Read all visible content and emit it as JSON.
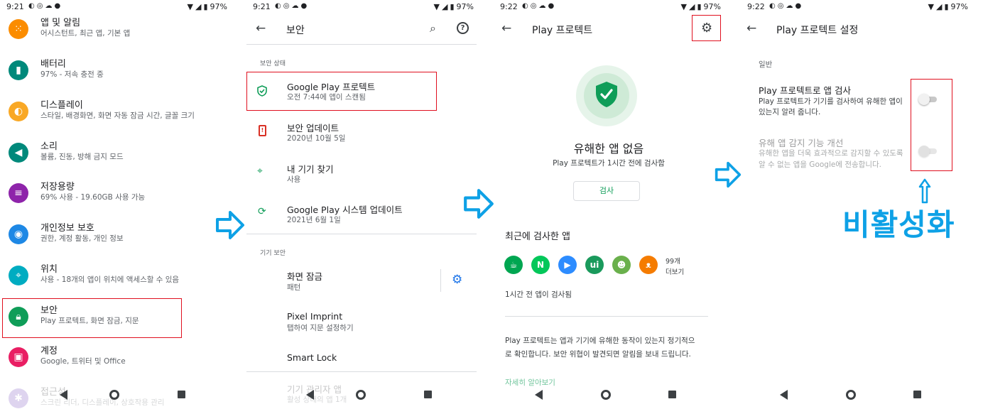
{
  "status": {
    "p1_time": "9:21",
    "p2_time": "9:21",
    "p3_time": "9:22",
    "p4_time": "9:22",
    "battery": "97%"
  },
  "settings": {
    "items": [
      {
        "title": "앱 및 알림",
        "subtitle": "어시스턴트, 최근 앱, 기본 앱",
        "color": "#fb8c00",
        "icon": "apps-grid-icon"
      },
      {
        "title": "배터리",
        "subtitle": "97% - 저속 충전 중",
        "color": "#00897b",
        "icon": "battery-icon"
      },
      {
        "title": "디스플레이",
        "subtitle": "스타일, 배경화면, 화면 자동 잠금 시간, 글꼴 크기",
        "color": "#f9a825",
        "icon": "brightness-icon"
      },
      {
        "title": "소리",
        "subtitle": "볼륨, 진동, 방해 금지 모드",
        "color": "#00897b",
        "icon": "speaker-icon"
      },
      {
        "title": "저장용량",
        "subtitle": "69% 사용 - 19.60GB 사용 가능",
        "color": "#8e24aa",
        "icon": "storage-icon"
      },
      {
        "title": "개인정보 보호",
        "subtitle": "권한, 계정 활동, 개인 정보",
        "color": "#1e88e5",
        "icon": "eye-icon"
      },
      {
        "title": "위치",
        "subtitle": "사용 - 18개의 앱이 위치에 액세스할 수 있음",
        "color": "#00acc1",
        "icon": "location-pin-icon"
      },
      {
        "title": "보안",
        "subtitle": "Play 프로텍트, 화면 잠금, 지문",
        "color": "#0f9d58",
        "icon": "lock-icon"
      },
      {
        "title": "계정",
        "subtitle": "Google, 트위터 및 Office",
        "color": "#e91e63",
        "icon": "account-icon"
      },
      {
        "title": "접근성",
        "subtitle": "스크린 리더, 디스플레이, 상호작용 관리",
        "color": "#7e57c2",
        "icon": "accessibility-icon"
      }
    ]
  },
  "security": {
    "title": "보안",
    "status_header": "보안 상태",
    "items": [
      {
        "title": "Google Play 프로텍트",
        "subtitle": "오전 7:44에 앱이 스캔됨"
      },
      {
        "title": "보안 업데이트",
        "subtitle": "2020년 10월 5일"
      },
      {
        "title": "내 기기 찾기",
        "subtitle": "사용"
      },
      {
        "title": "Google Play 시스템 업데이트",
        "subtitle": "2021년 6월 1일"
      }
    ],
    "device_header": "기기 보안",
    "device_items": [
      {
        "title": "화면 잠금",
        "subtitle": "패턴"
      },
      {
        "title": "Pixel Imprint",
        "subtitle": "탭하여 지문 설정하기"
      },
      {
        "title": "Smart Lock",
        "subtitle": ""
      },
      {
        "title": "기기 관리자 앱",
        "subtitle": "활성 상태의 앱 1개"
      }
    ]
  },
  "protect": {
    "title": "Play 프로텍트",
    "status_title": "유해한 앱 없음",
    "status_sub": "Play 프로텍트가 1시간 전에 검사함",
    "scan_button": "검사",
    "recent_title": "최근에 검사한 앱",
    "app_count": "99개",
    "more": "더보기",
    "scanned_note": "1시간 전 앱이 검사됨",
    "desc_line1": "Play 프로텍트는 앱과 기기에 유해한 동작이 있는지 정기적으",
    "desc_line2": "로 확인합니다. 보안 위협이 발견되면 알림을 보내 드립니다.",
    "learn_more": "자세히 알아보기",
    "accent": "#0f9d58"
  },
  "protect_settings": {
    "title": "Play 프로텍트 설정",
    "section": "일반",
    "opt1_title": "Play 프로텍트로 앱 검사",
    "opt1_line1": "Play 프로텍트가 기기를 검사하여 유해한 앱이",
    "opt1_line2": "있는지 알려 줍니다.",
    "opt1_enabled": false,
    "opt2_title": "유해 앱 감지 기능 개선",
    "opt2_line1": "유해한 앱을 더욱 효과적으로 감지할 수 있도록",
    "opt2_line2": "알 수 없는 앱을 Google에 전송합니다.",
    "opt2_enabled": false
  },
  "annotation": {
    "label": "비활성화",
    "color": "#0ea1e6",
    "highlight_color": "#e0101f"
  }
}
